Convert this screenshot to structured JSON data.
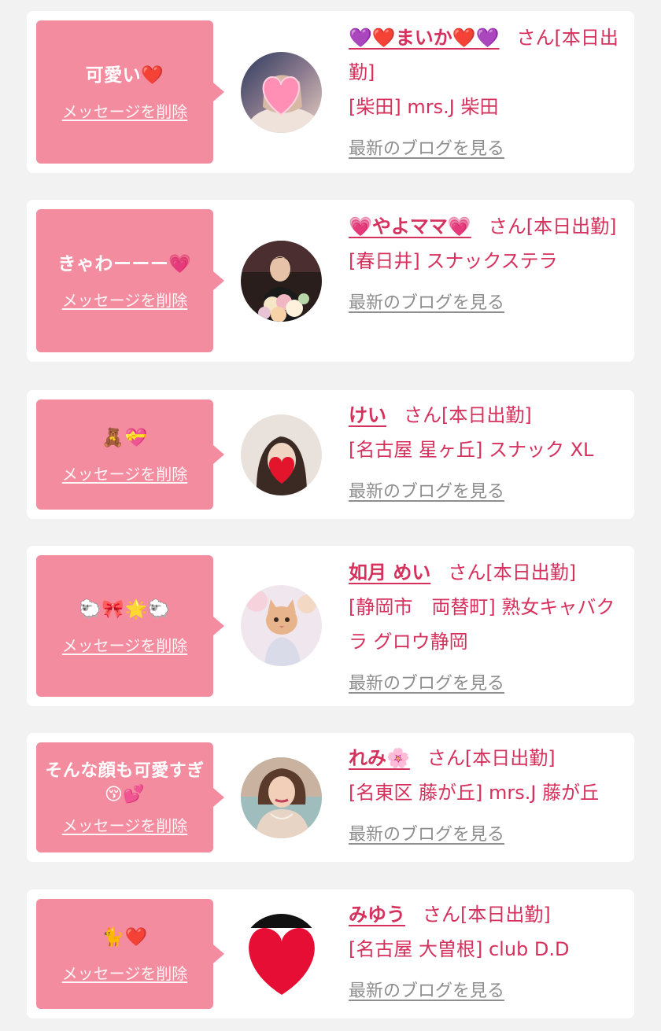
{
  "items": [
    {
      "message": "可愛い❤️",
      "delete_label": "メッセージを削除",
      "name": "💜❤️まいか❤️💜",
      "honorific": "さん",
      "status": "[本日出勤]",
      "store": "[柴田] mrs.J 柴田",
      "blog_label": "最新のブログを見る",
      "avatar_icon": "avatar-heart-face"
    },
    {
      "message": "きゃわーーー💗",
      "delete_label": "メッセージを削除",
      "name": "💗やよママ💗",
      "honorific": "さん",
      "status": "[本日出勤]",
      "store": "[春日井] スナックステラ",
      "blog_label": "最新のブログを見る",
      "avatar_icon": "avatar-flowers"
    },
    {
      "message": "🧸💝",
      "delete_label": "メッセージを削除",
      "name": "けい",
      "honorific": "さん",
      "status": "[本日出勤]",
      "store": "[名古屋 星ヶ丘] スナック XL",
      "blog_label": "最新のブログを見る",
      "avatar_icon": "avatar-heart-face"
    },
    {
      "message": "🐑🎀🌟🐑",
      "delete_label": "メッセージを削除",
      "name": "如月 めい",
      "honorific": "さん",
      "status": "[本日出勤]",
      "store": "[静岡市　両替町] 熟女キャバクラ グロウ静岡",
      "blog_label": "最新のブログを見る",
      "avatar_icon": "avatar-cat-filter"
    },
    {
      "message": "そんな顔も可愛すぎ😚💕",
      "delete_label": "メッセージを削除",
      "name": "れみ🌸",
      "honorific": "さん",
      "status": "[本日出勤]",
      "store": "[名東区 藤が丘] mrs.J 藤が丘",
      "blog_label": "最新のブログを見る",
      "avatar_icon": "avatar-portrait"
    },
    {
      "message": "🐈❤️",
      "delete_label": "メッセージを削除",
      "name": "みゆう",
      "honorific": "さん",
      "status": "[本日出勤]",
      "store": "[名古屋 大曽根] club D.D",
      "blog_label": "最新のブログを見る",
      "avatar_icon": "avatar-big-heart"
    }
  ],
  "colors": {
    "page_bg": "#f2f2f2",
    "card_bg": "#ffffff",
    "bubble_bg": "#f48ca0",
    "accent_text": "#d6305c",
    "blog_link": "#8e8e8e"
  }
}
